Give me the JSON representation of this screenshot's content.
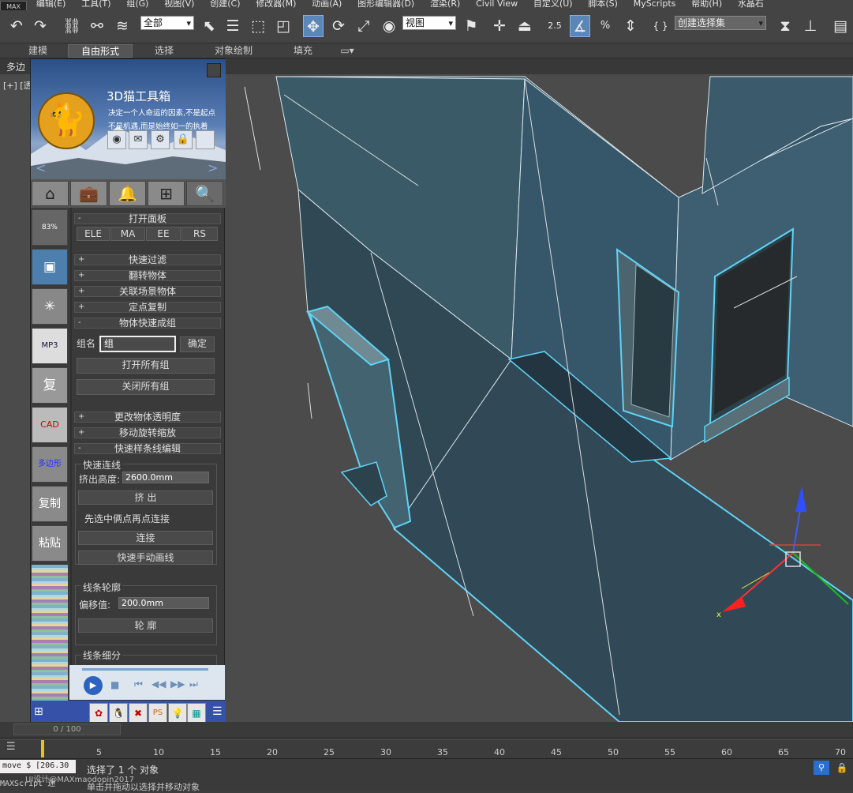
{
  "menu": {
    "logo": "MAX",
    "items": [
      "编辑(E)",
      "工具(T)",
      "组(G)",
      "视图(V)",
      "创建(C)",
      "修改器(M)",
      "动画(A)",
      "图形编辑器(D)",
      "渲染(R)",
      "Civil View",
      "自定义(U)",
      "脚本(S)",
      "MyScripts",
      "帮助(H)",
      "水晶石"
    ]
  },
  "toolbar": {
    "selection_filter": "全部",
    "ref_coord": "视图",
    "named_selection": "创建选择集",
    "snap_label": "2.5",
    "angle_snap_label": "%"
  },
  "ribbon": {
    "tabs": [
      "建模",
      "自由形式",
      "选择",
      "对象绘制",
      "填充"
    ],
    "active": "自由形式"
  },
  "subbar": {
    "label": "多边"
  },
  "viewport": {
    "label": "[+] [透"
  },
  "panel": {
    "title": "3D猫工具箱",
    "slogan_1": "决定一个人命运的因素,不是起点",
    "slogan_2": "不是机遇,而是始终如一的执着",
    "nav_prev": "<",
    "nav_next": ">",
    "side_labels": {
      "mp3": "MP3",
      "fu": "复",
      "cad": "CAD",
      "poly": "多边形",
      "copy": "复制",
      "paste": "粘贴",
      "pct": "83%"
    },
    "rollouts": {
      "open_panel": "打开面板",
      "quick_filter": "快速过滤",
      "flip": "翻转物体",
      "assoc_scene": "关联场景物体",
      "point_copy": "定点复制",
      "quick_group": "物体快速成组",
      "transparency": "更改物体透明度",
      "move_rotate": "移动旋转缩放",
      "spline_edit": "快速样条线编辑"
    },
    "open_panel_buttons": [
      "ELE",
      "MA",
      "EE",
      "RS"
    ],
    "group": {
      "label": "组名",
      "value": "组",
      "confirm": "确定",
      "open_all": "打开所有组",
      "close_all": "关闭所有组"
    },
    "spline": {
      "quick_connect": "快速连线",
      "extrude_height_label": "挤出高度:",
      "extrude_height": "2600.0mm",
      "extrude_btn": "挤 出",
      "hint": "先选中俩点再点连接",
      "connect_btn": "连接",
      "draw_btn": "快速手动画线",
      "outline_group": "线条轮廓",
      "offset_label": "偏移值:",
      "offset_value": "200.0mm",
      "outline_btn": "轮 廓",
      "subdivide_group": "线条细分"
    }
  },
  "timeline": {
    "slider": "0 / 100",
    "ticks": [
      "5",
      "10",
      "15",
      "20",
      "25",
      "30",
      "35",
      "40",
      "45",
      "50",
      "55",
      "60",
      "65",
      "70"
    ]
  },
  "status": {
    "maxscript": "move $ [206.30",
    "maxscript_label": "MAXScript 迷",
    "line1": "选择了 1 个 对象",
    "line2": "单击并拖动以选择并移动对象",
    "watermark": "UI设计@MAXmaodopin2017"
  }
}
